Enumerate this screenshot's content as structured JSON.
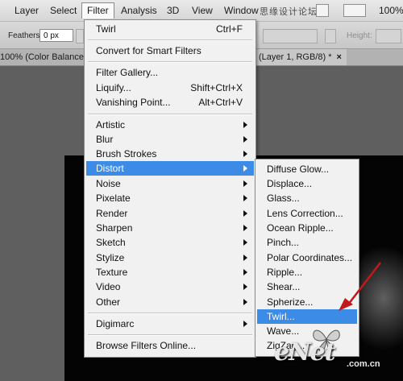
{
  "menubar": {
    "items": [
      {
        "label": "Layer"
      },
      {
        "label": "Select"
      },
      {
        "label": "Filter"
      },
      {
        "label": "Analysis"
      },
      {
        "label": "3D"
      },
      {
        "label": "View"
      },
      {
        "label": "Window"
      }
    ],
    "watermark": "思缘设计论坛",
    "zoom": "100%"
  },
  "optionsbar": {
    "feather_label": "Feathers:",
    "feather_value": "0 px",
    "height_label": "Height:"
  },
  "tabs": {
    "left": "100% (Color Balance",
    "right": "(Layer 1, RGB/8) *"
  },
  "filter_menu": {
    "last_filter": {
      "label": "Twirl",
      "shortcut": "Ctrl+F"
    },
    "convert": "Convert for Smart Filters",
    "gallery": "Filter Gallery...",
    "liquify": {
      "label": "Liquify...",
      "shortcut": "Shift+Ctrl+X"
    },
    "vanishing": {
      "label": "Vanishing Point...",
      "shortcut": "Alt+Ctrl+V"
    },
    "groups": [
      "Artistic",
      "Blur",
      "Brush Strokes",
      "Distort",
      "Noise",
      "Pixelate",
      "Render",
      "Sharpen",
      "Sketch",
      "Stylize",
      "Texture",
      "Video",
      "Other"
    ],
    "digimarc": "Digimarc",
    "browse": "Browse Filters Online..."
  },
  "distort_menu": {
    "items": [
      "Diffuse Glow...",
      "Displace...",
      "Glass...",
      "Lens Correction...",
      "Ocean Ripple...",
      "Pinch...",
      "Polar Coordinates...",
      "Ripple...",
      "Shear...",
      "Spherize...",
      "Twirl...",
      "Wave...",
      "ZigZag..."
    ]
  },
  "watermark": {
    "brand": "eNet",
    "sub": ".com.cn"
  },
  "colors": {
    "highlight": "#3c8ce7",
    "arrow": "#c0181b"
  }
}
